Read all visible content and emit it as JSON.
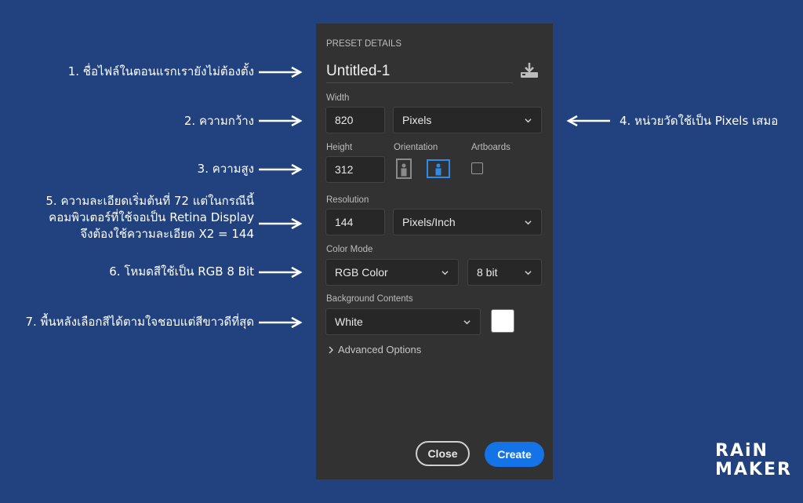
{
  "annotations": {
    "a1": "1. ชื่อไฟล์ในตอนแรกเรายังไม่ต้องตั้ง",
    "a2": "2. ความกว้าง",
    "a3": "3. ความสูง",
    "a4": "4. หน่วยวัดใช้เป็น Pixels เสมอ",
    "a5_line1": "5. ความละเอียดเริ่มต้นที่ 72 แต่ในกรณีนี้",
    "a5_line2": "คอมพิวเตอร์ที่ใช้จอเป็น Retina Display",
    "a5_line3": "จึงต้องใช้ความละเอียด X2 = 144",
    "a6": "6. โหมดสีใช้เป็น RGB 8 Bit",
    "a7": "7. พื้นหลังเลือกสีได้ตามใจชอบแต่สีขาวดีที่สุด"
  },
  "panel": {
    "header": "PRESET DETAILS",
    "doc_name": "Untitled-1",
    "width_label": "Width",
    "width_value": "820",
    "width_unit": "Pixels",
    "height_label": "Height",
    "height_value": "312",
    "orientation_label": "Orientation",
    "orientation_selected": "landscape",
    "artboards_label": "Artboards",
    "artboards_checked": false,
    "resolution_label": "Resolution",
    "resolution_value": "144",
    "resolution_unit": "Pixels/Inch",
    "color_mode_label": "Color Mode",
    "color_mode_value": "RGB Color",
    "bit_depth_value": "8 bit",
    "background_label": "Background Contents",
    "background_value": "White",
    "background_swatch": "#ffffff",
    "advanced_label": "Advanced Options",
    "close_label": "Close",
    "create_label": "Create"
  },
  "colors": {
    "page_bg": "#21427e",
    "panel_bg": "#323232",
    "accent": "#1473e6",
    "selected_orientation": "#2d8ceb"
  },
  "logo": {
    "line1": "RAiN",
    "line2": "MAKER"
  }
}
